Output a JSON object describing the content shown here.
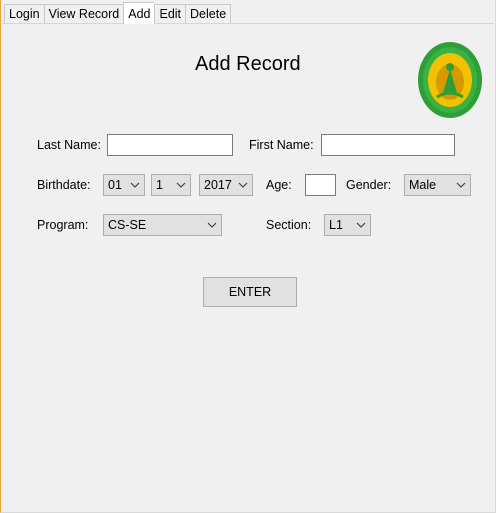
{
  "tabs": [
    {
      "label": "Login",
      "active": false
    },
    {
      "label": "View Record",
      "active": false
    },
    {
      "label": "Add",
      "active": true
    },
    {
      "label": "Edit",
      "active": false
    },
    {
      "label": "Delete",
      "active": false
    }
  ],
  "form": {
    "title": "Add Record",
    "last_name_label": "Last Name:",
    "last_name_value": "",
    "first_name_label": "First Name:",
    "first_name_value": "",
    "birthdate_label": "Birthdate:",
    "birth_month": "01",
    "birth_day": "1",
    "birth_year": "2017",
    "age_label": "Age:",
    "age_value": "",
    "gender_label": "Gender:",
    "gender_value": "Male",
    "program_label": "Program:",
    "program_value": "CS-SE",
    "section_label": "Section:",
    "section_value": "L1",
    "enter_label": "ENTER"
  },
  "logo": {
    "icon": "university-seal-icon",
    "colors": {
      "ring": "#2e9e36",
      "center": "#f2c200",
      "inner": "#d69a00"
    }
  }
}
